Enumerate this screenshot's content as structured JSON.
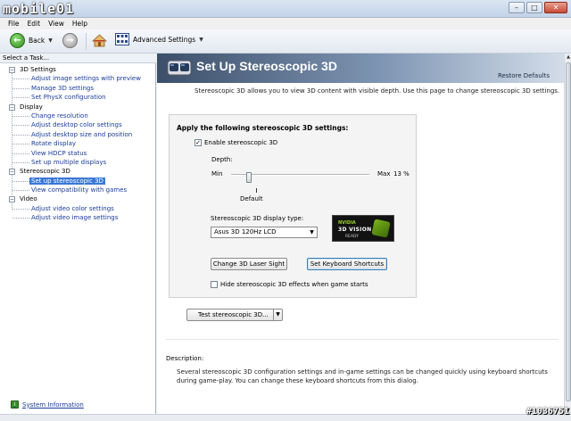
{
  "window": {
    "logo_text": "mobile01",
    "min": "–",
    "max": "□",
    "close": "✕"
  },
  "menu": [
    "File",
    "Edit",
    "View",
    "Help"
  ],
  "toolbar": {
    "back_label": "Back",
    "advanced_settings_label": "Advanced Settings"
  },
  "task_panel": {
    "heading": "Select a Task...",
    "tree": [
      {
        "label": "3D Settings",
        "type": "cat"
      },
      {
        "label": "Adjust image settings with preview",
        "type": "sub"
      },
      {
        "label": "Manage 3D settings",
        "type": "sub"
      },
      {
        "label": "Set PhysX configuration",
        "type": "sub"
      },
      {
        "label": "Display",
        "type": "cat"
      },
      {
        "label": "Change resolution",
        "type": "sub"
      },
      {
        "label": "Adjust desktop color settings",
        "type": "sub"
      },
      {
        "label": "Adjust desktop size and position",
        "type": "sub"
      },
      {
        "label": "Rotate display",
        "type": "sub"
      },
      {
        "label": "View HDCP status",
        "type": "sub"
      },
      {
        "label": "Set up multiple displays",
        "type": "sub"
      },
      {
        "label": "Stereoscopic 3D",
        "type": "cat"
      },
      {
        "label": "Set up stereoscopic 3D",
        "type": "sub",
        "selected": true
      },
      {
        "label": "View compatibility with games",
        "type": "sub"
      },
      {
        "label": "Video",
        "type": "cat"
      },
      {
        "label": "Adjust video color settings",
        "type": "sub"
      },
      {
        "label": "Adjust video image settings",
        "type": "sub"
      }
    ],
    "system_info": "System Information"
  },
  "page": {
    "title": "Set Up Stereoscopic 3D",
    "restore_defaults": "Restore Defaults",
    "intro": "Stereoscopic 3D allows you to view 3D content with visible depth. Use this page to change stereoscopic 3D settings.",
    "settings_heading": "Apply the following stereoscopic 3D settings:",
    "enable_label": "Enable stereoscopic 3D",
    "enable_checked": true,
    "depth_label": "Depth:",
    "slider_min": "Min",
    "slider_max": "Max",
    "slider_value_text": "13 %",
    "slider_value": 13,
    "default_label": "Default",
    "display_type_label": "Stereoscopic 3D display type:",
    "display_type_value": "Asus 3D 120Hz LCD",
    "vision_badge": {
      "line1": "NVIDIA",
      "line2": "3D VISION",
      "line3": "READY"
    },
    "laser_button": "Change 3D Laser Sight",
    "keys_button": "Set Keyboard Shortcuts",
    "hide_effects_label": "Hide stereoscopic 3D effects when game starts",
    "hide_effects_checked": false,
    "test_button": "Test stereoscopic 3D...",
    "description_label": "Description:",
    "description_text": "Several stereoscopic 3D configuration settings and in-game settings can be changed quickly using keyboard shortcuts during game-play. You can change these keyboard shortcuts from this dialog."
  },
  "watermark": "#1036751"
}
